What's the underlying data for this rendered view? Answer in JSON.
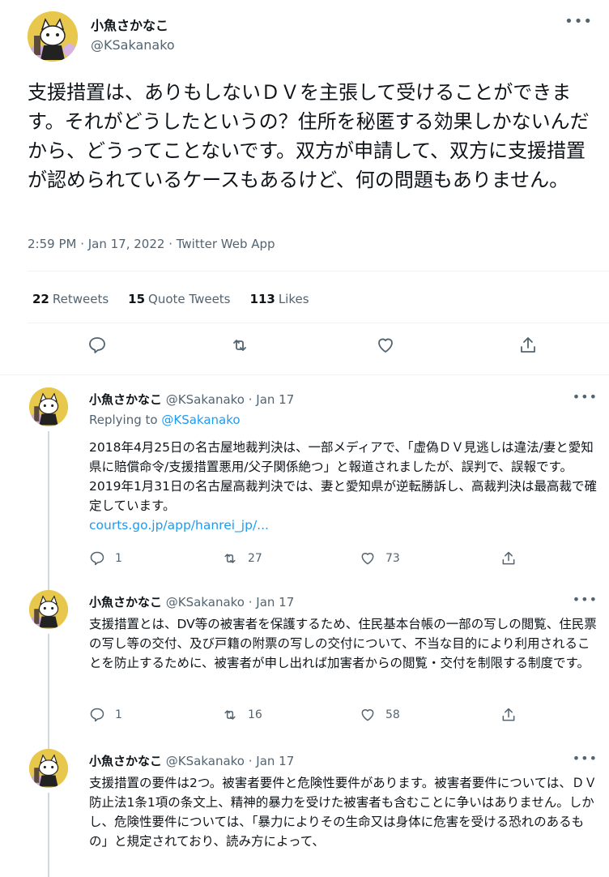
{
  "main": {
    "name": "小魚さかなこ",
    "handle": "@KSakanako",
    "text": "支援措置は、ありもしないＤＶを主張して受けることができます。それがどうしたというの？住所を秘匿する効果しかないんだから、どうってことないです。双方が申請して、双方に支援措置が認められているケースもあるけど、何の問題もありません。",
    "meta": "2:59 PM · Jan 17, 2022 · Twitter Web App",
    "retweets_count": "22",
    "retweets_label": "Retweets",
    "quotes_count": "15",
    "quotes_label": "Quote Tweets",
    "likes_count": "113",
    "likes_label": "Likes"
  },
  "replies": [
    {
      "name": "小魚さかなこ",
      "handle_date": "@KSakanako · Jan 17",
      "replying_label": "Replying to",
      "replying_handle": "@KSakanako",
      "text": "2018年4月25日の名古屋地裁判決は、一部メディアで、「虚偽ＤＶ見逃しは違法/妻と愛知県に賠償命令/支援措置悪用/父子関係絶つ」と報道されましたが、誤判で、誤報です。2019年1月31日の名古屋高裁判決では、妻と愛知県が逆転勝訴し、高裁判決は最高裁で確定しています。",
      "link": "courts.go.jp/app/hanrei_jp/...",
      "replies": "1",
      "retweets": "27",
      "likes": "73"
    },
    {
      "name": "小魚さかなこ",
      "handle_date": "@KSakanako · Jan 17",
      "text": "支援措置とは、DV等の被害者を保護するため、住民基本台帳の一部の写しの閲覧、住民票の写し等の交付、及び戸籍の附票の写しの交付について、不当な目的により利用されることを防止するために、被害者が申し出れば加害者からの閲覧・交付を制限する制度です。",
      "replies": "1",
      "retweets": "16",
      "likes": "58"
    },
    {
      "name": "小魚さかなこ",
      "handle_date": "@KSakanako · Jan 17",
      "text": "支援措置の要件は2つ。被害者要件と危険性要件があります。被害者要件については、ＤＶ防止法1条1項の条文上、精神的暴力を受けた被害者も含むことに争いはありません。しかし、危険性要件については、「暴力によりその生命又は身体に危害を受ける恐れのあるもの」と規定されており、読み方によって、"
    }
  ],
  "icons": {
    "more": "more-icon",
    "reply": "reply-icon",
    "retweet": "retweet-icon",
    "like": "heart-icon",
    "share": "share-icon"
  },
  "colors": {
    "accent": "#1d9bf0",
    "secondary_text": "#536471",
    "divider": "#eff3f4"
  }
}
